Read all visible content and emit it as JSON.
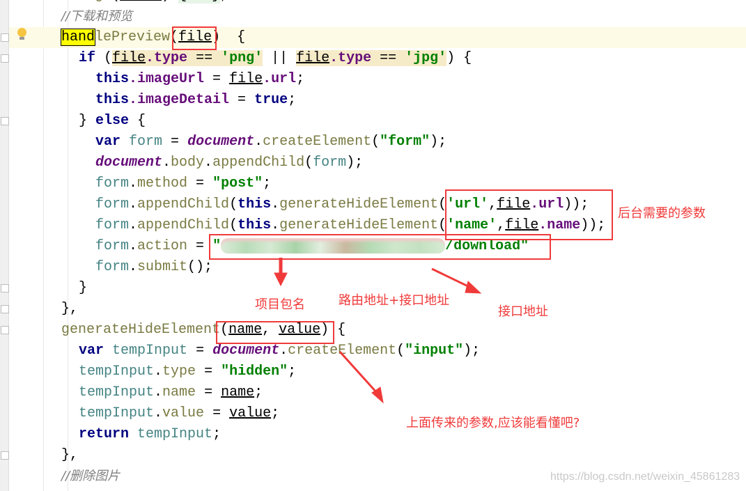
{
  "colors": {
    "annotation": "#f03a3a",
    "keyword": "#000080",
    "property": "#660e7a",
    "string": "#008000",
    "comment": "#808080"
  },
  "code_lines": [
    {
      "indent": 0,
      "tokens": [
        [
          "change",
          "m"
        ],
        [
          "(",
          ""
        ],
        [
          "event",
          "pa"
        ],
        [
          ") ",
          ""
        ],
        [
          "{...}",
          "g"
        ],
        [
          ",",
          ""
        ]
      ]
    },
    {
      "indent": 0,
      "tokens": [
        [
          "//下载和预览",
          "c"
        ]
      ]
    },
    {
      "indent": 0,
      "tokens": [
        [
          "hand",
          "y"
        ],
        [
          "lePreview",
          "m"
        ],
        [
          "(",
          ""
        ],
        [
          "file",
          "pa"
        ],
        [
          ")  {",
          ""
        ]
      ]
    },
    {
      "indent": 1,
      "tokens": [
        [
          "if",
          "k"
        ],
        [
          " (",
          ""
        ],
        [
          "file",
          "pa w"
        ],
        [
          ".type",
          "p w"
        ],
        [
          " == ",
          "w"
        ],
        [
          "'png'",
          "s w"
        ],
        [
          " || ",
          ""
        ],
        [
          "file",
          "pa w"
        ],
        [
          ".type",
          "p w"
        ],
        [
          " == ",
          "w"
        ],
        [
          "'jpg'",
          "s w"
        ],
        [
          ") {",
          ""
        ]
      ]
    },
    {
      "indent": 2,
      "tokens": [
        [
          "this",
          "k"
        ],
        [
          ".imageUrl",
          "p"
        ],
        [
          " = ",
          ""
        ],
        [
          "file",
          "pa"
        ],
        [
          ".url",
          "p"
        ],
        [
          ";",
          ""
        ]
      ]
    },
    {
      "indent": 2,
      "tokens": [
        [
          "this",
          "k"
        ],
        [
          ".imageDetail",
          "p"
        ],
        [
          " = ",
          ""
        ],
        [
          "true",
          "k"
        ],
        [
          ";",
          ""
        ]
      ]
    },
    {
      "indent": 1,
      "tokens": [
        [
          "} ",
          ""
        ],
        [
          "else",
          "k"
        ],
        [
          " {",
          ""
        ]
      ]
    },
    {
      "indent": 2,
      "tokens": [
        [
          "var",
          "k"
        ],
        [
          " ",
          ""
        ],
        [
          "form",
          "v"
        ],
        [
          " = ",
          ""
        ],
        [
          "document",
          "d"
        ],
        [
          ".",
          ""
        ],
        [
          "createElement",
          "m"
        ],
        [
          "(",
          ""
        ],
        [
          "\"form\"",
          "s"
        ],
        [
          ");",
          ""
        ]
      ]
    },
    {
      "indent": 2,
      "tokens": [
        [
          "document",
          "d"
        ],
        [
          ".",
          ""
        ],
        [
          "body",
          "m"
        ],
        [
          ".",
          ""
        ],
        [
          "appendChild",
          "m"
        ],
        [
          "(",
          ""
        ],
        [
          "form",
          "v"
        ],
        [
          ");",
          ""
        ]
      ]
    },
    {
      "indent": 2,
      "tokens": [
        [
          "form",
          "v"
        ],
        [
          ".",
          ""
        ],
        [
          "method",
          "m"
        ],
        [
          " = ",
          ""
        ],
        [
          "\"post\"",
          "s"
        ],
        [
          ";",
          ""
        ]
      ]
    },
    {
      "indent": 2,
      "tokens": [
        [
          "form",
          "v"
        ],
        [
          ".",
          ""
        ],
        [
          "appendChild",
          "m"
        ],
        [
          "(",
          ""
        ],
        [
          "this",
          "k"
        ],
        [
          ".",
          ""
        ],
        [
          "generateHideElement",
          "m"
        ],
        [
          "(",
          ""
        ],
        [
          "'url'",
          "s"
        ],
        [
          ",",
          ""
        ],
        [
          "file",
          "pa"
        ],
        [
          ".url",
          "p"
        ],
        [
          "));",
          ""
        ]
      ]
    },
    {
      "indent": 2,
      "tokens": [
        [
          "form",
          "v"
        ],
        [
          ".",
          ""
        ],
        [
          "appendChild",
          "m"
        ],
        [
          "(",
          ""
        ],
        [
          "this",
          "k"
        ],
        [
          ".",
          ""
        ],
        [
          "generateHideElement",
          "m"
        ],
        [
          "(",
          ""
        ],
        [
          "'name'",
          "s"
        ],
        [
          ",",
          ""
        ],
        [
          "file",
          "pa"
        ],
        [
          ".name",
          "p"
        ],
        [
          "));",
          ""
        ]
      ]
    },
    {
      "indent": 2,
      "tokens": [
        [
          "form",
          "v"
        ],
        [
          ".",
          ""
        ],
        [
          "action",
          "m"
        ],
        [
          " = ",
          ""
        ],
        [
          "\"",
          "s"
        ],
        [
          "",
          "blur"
        ],
        [
          "/download\"",
          "s"
        ]
      ]
    },
    {
      "indent": 2,
      "tokens": [
        [
          "form",
          "v"
        ],
        [
          ".",
          ""
        ],
        [
          "submit",
          "m"
        ],
        [
          "();",
          ""
        ]
      ]
    },
    {
      "indent": 1,
      "tokens": [
        [
          "}",
          ""
        ]
      ]
    },
    {
      "indent": 0,
      "tokens": [
        [
          "},",
          ""
        ]
      ]
    },
    {
      "indent": 0,
      "tokens": [
        [
          "generateHideElement",
          "m"
        ],
        [
          "(",
          ""
        ],
        [
          "name",
          "pa"
        ],
        [
          ", ",
          ""
        ],
        [
          "value",
          "pa"
        ],
        [
          ") {",
          ""
        ]
      ]
    },
    {
      "indent": 1,
      "tokens": [
        [
          "var",
          "k"
        ],
        [
          " ",
          ""
        ],
        [
          "tempInput",
          "v"
        ],
        [
          " = ",
          ""
        ],
        [
          "document",
          "d"
        ],
        [
          ".",
          ""
        ],
        [
          "createElement",
          "m"
        ],
        [
          "(",
          ""
        ],
        [
          "\"input\"",
          "s"
        ],
        [
          ");",
          ""
        ]
      ]
    },
    {
      "indent": 1,
      "tokens": [
        [
          "tempInput",
          "v"
        ],
        [
          ".",
          ""
        ],
        [
          "type",
          "m"
        ],
        [
          " = ",
          ""
        ],
        [
          "\"hidden\"",
          "s"
        ],
        [
          ";",
          ""
        ]
      ]
    },
    {
      "indent": 1,
      "tokens": [
        [
          "tempInput",
          "v"
        ],
        [
          ".",
          ""
        ],
        [
          "name",
          "m"
        ],
        [
          " = ",
          ""
        ],
        [
          "name",
          "pa"
        ],
        [
          ";",
          ""
        ]
      ]
    },
    {
      "indent": 1,
      "tokens": [
        [
          "tempInput",
          "v"
        ],
        [
          ".",
          ""
        ],
        [
          "value",
          "m"
        ],
        [
          " = ",
          ""
        ],
        [
          "value",
          "pa"
        ],
        [
          ";",
          ""
        ]
      ]
    },
    {
      "indent": 1,
      "tokens": [
        [
          "return",
          "k"
        ],
        [
          " ",
          ""
        ],
        [
          "tempInput",
          "v"
        ],
        [
          ";",
          ""
        ]
      ]
    },
    {
      "indent": 0,
      "tokens": [
        [
          "},",
          ""
        ]
      ]
    },
    {
      "indent": 0,
      "tokens": [
        [
          "//删除图片",
          "c"
        ]
      ]
    }
  ],
  "annotations": {
    "backend_params": "后台需要的参数",
    "project_name": "项目包名",
    "route_plus_api": "路由地址+接口地址",
    "api_address": "接口地址",
    "params_passed": "上面传来的参数,应该能看懂吧?"
  },
  "watermark": "https://blog.csdn.net/weixin_45861283"
}
